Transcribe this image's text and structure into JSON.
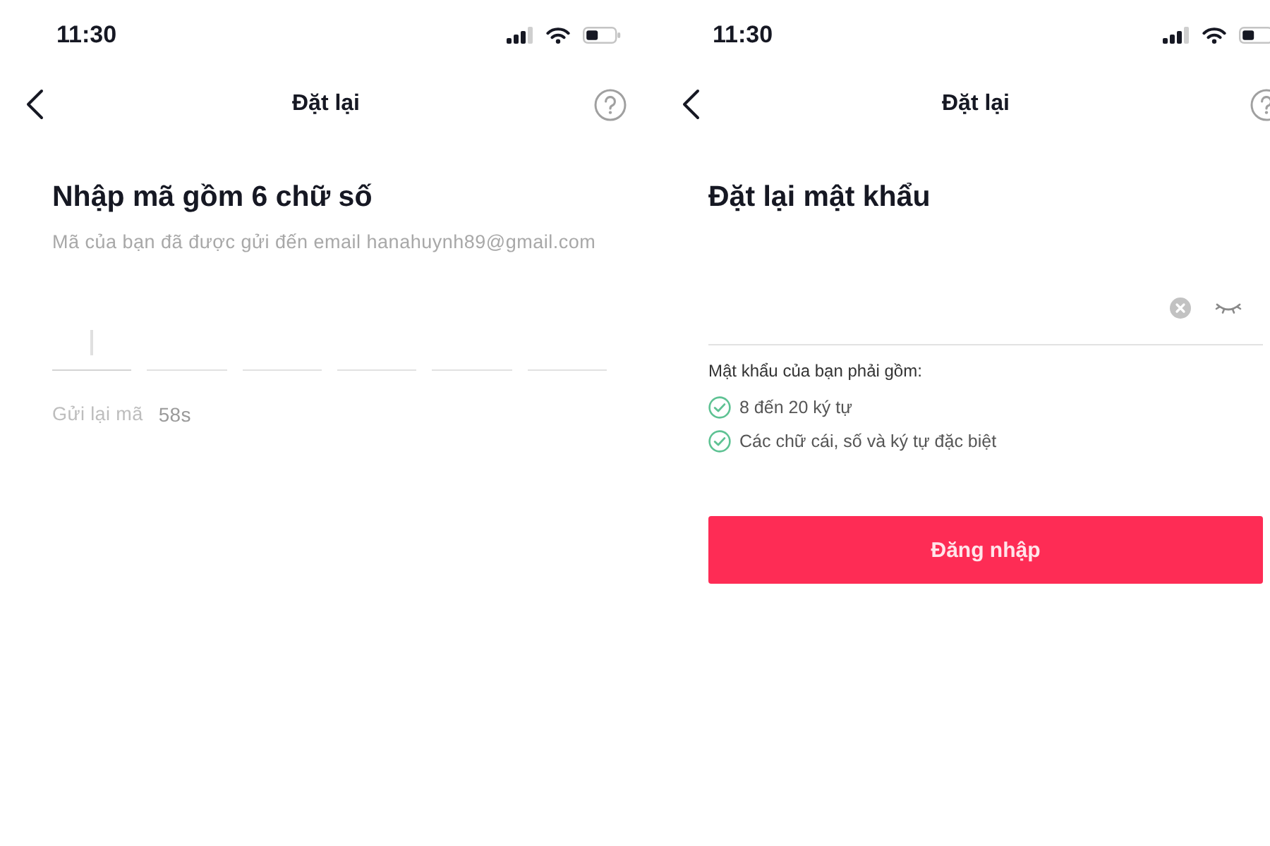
{
  "screens": [
    {
      "kind": "code_entry",
      "status_bar": {
        "time": "11:30"
      },
      "nav": {
        "title": "Đặt lại"
      },
      "heading": "Nhập mã gồm 6 chữ số",
      "subtitle": "Mã của bạn đã được gửi đến email hanahuynh89@gmail.com",
      "code_fields": [
        {
          "focused": true
        },
        {
          "focused": false
        },
        {
          "focused": false
        },
        {
          "focused": false
        },
        {
          "focused": false
        },
        {
          "focused": false
        }
      ],
      "resend": {
        "label": "Gửi lại mã",
        "countdown": "58s"
      }
    },
    {
      "kind": "password_reset",
      "status_bar": {
        "time": "11:30"
      },
      "nav": {
        "title": "Đặt lại"
      },
      "heading": "Đặt lại mật khẩu",
      "password_field": {
        "password_visible": false
      },
      "requirements": {
        "title": "Mật khẩu của bạn phải gồm:",
        "items": [
          {
            "text": "8 đến 20 ký tự",
            "met": true
          },
          {
            "text": "Các chữ cái, số và ký tự đặc biệt",
            "met": true
          }
        ]
      },
      "button": "Đăng nhập"
    }
  ]
}
